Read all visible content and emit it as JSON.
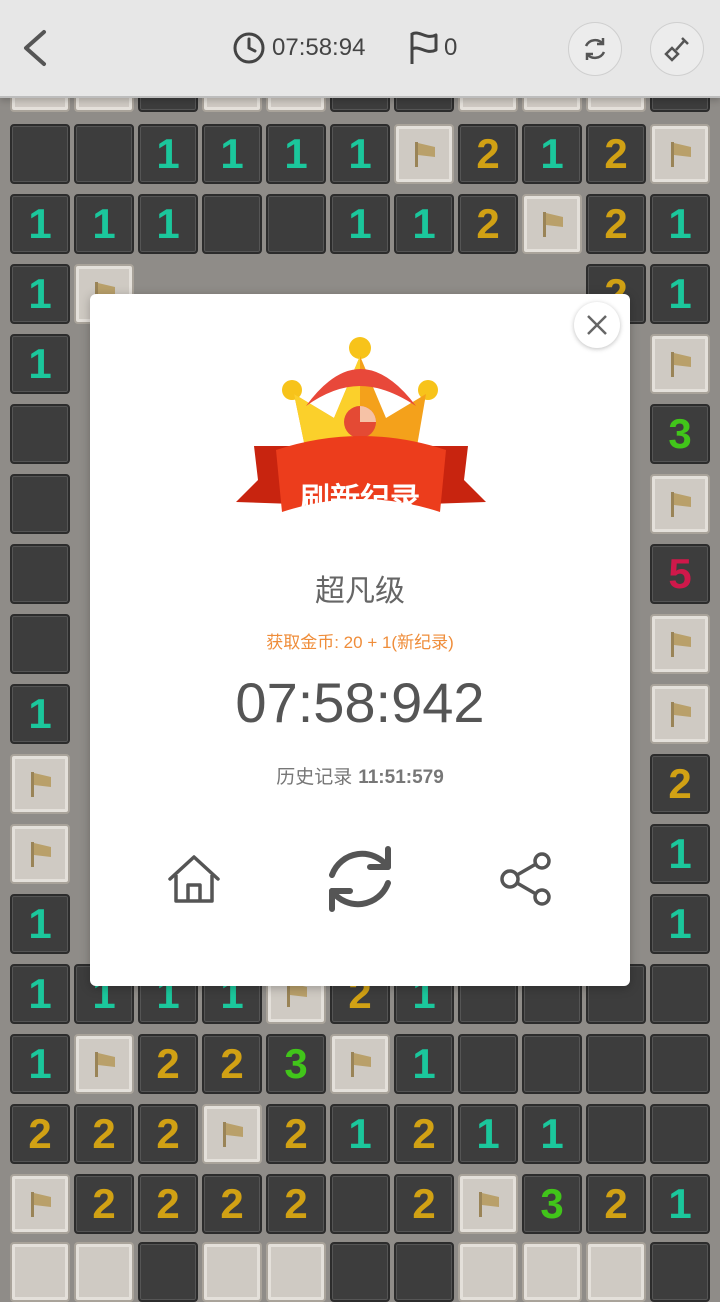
{
  "header": {
    "timer": "07:58:94",
    "flag_count": "0",
    "icons": {
      "back": "back-arrow-icon",
      "clock": "clock-icon",
      "flag": "flag-icon",
      "restart": "refresh-icon",
      "tool": "shovel-icon"
    }
  },
  "dialog": {
    "banner": "刷新纪录",
    "level": "超凡级",
    "coins": "获取金币: 20 + 1(新纪录)",
    "time": "07:58:942",
    "history_label": "历史记录",
    "history_value": "11:51:579",
    "icons": {
      "close": "close-icon",
      "home": "home-icon",
      "restart": "restart-icon",
      "share": "share-icon"
    }
  },
  "colors": {
    "one": "#1bc79c",
    "two": "#d1a114",
    "three": "#41c51a",
    "five": "#d0184a",
    "coins": "#ef8d3a"
  },
  "board": {
    "rows": [
      [
        "E",
        "E",
        "1",
        "1",
        "1",
        "1",
        "F",
        "2",
        "1",
        "2",
        "F"
      ],
      [
        "1",
        "1",
        "1",
        "E",
        "E",
        "1",
        "1",
        "2",
        "F",
        "2",
        "1"
      ],
      [
        "1",
        "F",
        "",
        "",
        "",
        "",
        "",
        "",
        "",
        "2",
        "1"
      ],
      [
        "1",
        "",
        "",
        "",
        "",
        "",
        "",
        "",
        "",
        "",
        "F"
      ],
      [
        "E",
        "",
        "",
        "",
        "",
        "",
        "",
        "",
        "",
        "",
        "3"
      ],
      [
        "E",
        "",
        "",
        "",
        "",
        "",
        "",
        "",
        "",
        "",
        "F"
      ],
      [
        "E",
        "",
        "",
        "",
        "",
        "",
        "",
        "",
        "",
        "",
        "5"
      ],
      [
        "E",
        "",
        "",
        "",
        "",
        "",
        "",
        "",
        "",
        "",
        "F"
      ],
      [
        "1",
        "",
        "",
        "",
        "",
        "",
        "",
        "",
        "",
        "",
        "F"
      ],
      [
        "F",
        "",
        "",
        "",
        "",
        "",
        "",
        "",
        "",
        "",
        "2"
      ],
      [
        "F",
        "",
        "",
        "",
        "",
        "",
        "",
        "",
        "",
        "",
        "1"
      ],
      [
        "1",
        "",
        "",
        "",
        "",
        "",
        "",
        "",
        "",
        "",
        "1"
      ],
      [
        "1",
        "1",
        "1",
        "1",
        "F",
        "2",
        "1",
        "E",
        "E",
        "E",
        "E"
      ],
      [
        "1",
        "F",
        "2",
        "2",
        "3",
        "F",
        "1",
        "E",
        "E",
        "E",
        "E"
      ],
      [
        "2",
        "2",
        "2",
        "F",
        "2",
        "1",
        "2",
        "1",
        "1",
        "E",
        "E"
      ],
      [
        "F",
        "2",
        "2",
        "2",
        "2",
        "E",
        "2",
        "F",
        "3",
        "2",
        "1"
      ]
    ]
  }
}
